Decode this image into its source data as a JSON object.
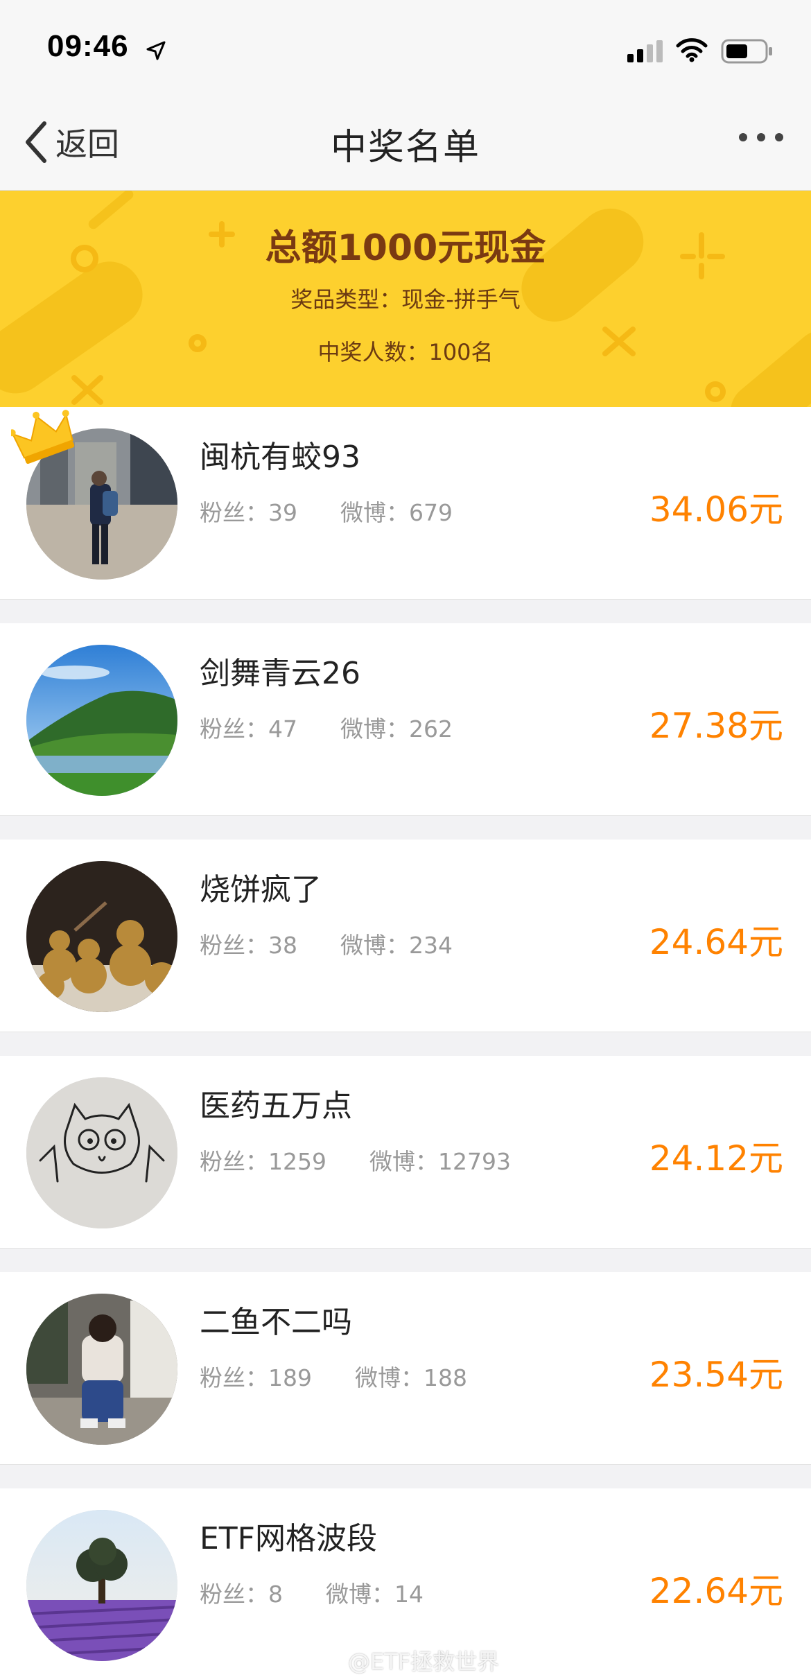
{
  "status_bar": {
    "time": "09:46"
  },
  "nav": {
    "back_label": "返回",
    "title": "中奖名单"
  },
  "banner": {
    "amount": "总额1000元现金",
    "prize_type": "奖品类型：现金-拼手气",
    "winner_count": "中奖人数：100名"
  },
  "winners": [
    {
      "name": "闽杭有蛟93",
      "fans": "粉丝：39",
      "weibo": "微博：679",
      "amount": "34.06元"
    },
    {
      "name": "剑舞青云26",
      "fans": "粉丝：47",
      "weibo": "微博：262",
      "amount": "27.38元"
    },
    {
      "name": "烧饼疯了",
      "fans": "粉丝：38",
      "weibo": "微博：234",
      "amount": "24.64元"
    },
    {
      "name": "医药五万点",
      "fans": "粉丝：1259",
      "weibo": "微博：12793",
      "amount": "24.12元"
    },
    {
      "name": "二鱼不二吗",
      "fans": "粉丝：189",
      "weibo": "微博：188",
      "amount": "23.54元"
    },
    {
      "name": "ETF网格波段",
      "fans": "粉丝：8",
      "weibo": "微博：14",
      "amount": "22.64元"
    }
  ],
  "watermark": "@ETF拯救世界",
  "colors": {
    "banner": "#fdd02e",
    "amount": "#ff8200",
    "banner_text": "#7a3a12"
  }
}
